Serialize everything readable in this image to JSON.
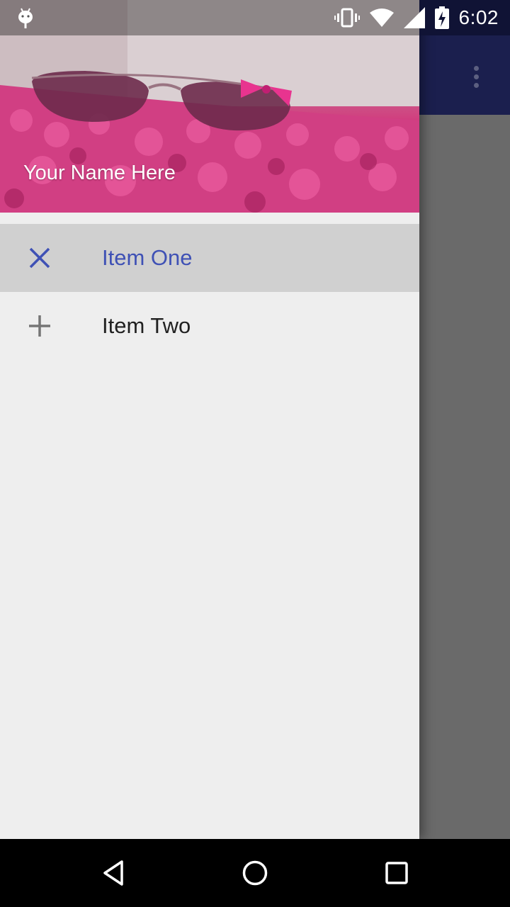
{
  "status_bar": {
    "time": "6:02",
    "icons": [
      "android-debug-icon",
      "vibrate-icon",
      "wifi-icon",
      "cell-signal-icon",
      "battery-charging-icon"
    ]
  },
  "app": {
    "toolbar_color": "#1b1f4e",
    "overflow_icon": "more-vert-icon"
  },
  "drawer": {
    "header": {
      "name": "Your Name Here",
      "image": "pink-sunglasses-on-rug"
    },
    "items": [
      {
        "label": "Item One",
        "icon": "close-icon",
        "selected": true
      },
      {
        "label": "Item Two",
        "icon": "plus-icon",
        "selected": false
      }
    ],
    "accent_color": "#3f51b5"
  },
  "nav_bar": {
    "buttons": [
      "back-icon",
      "home-icon",
      "recents-icon"
    ]
  }
}
